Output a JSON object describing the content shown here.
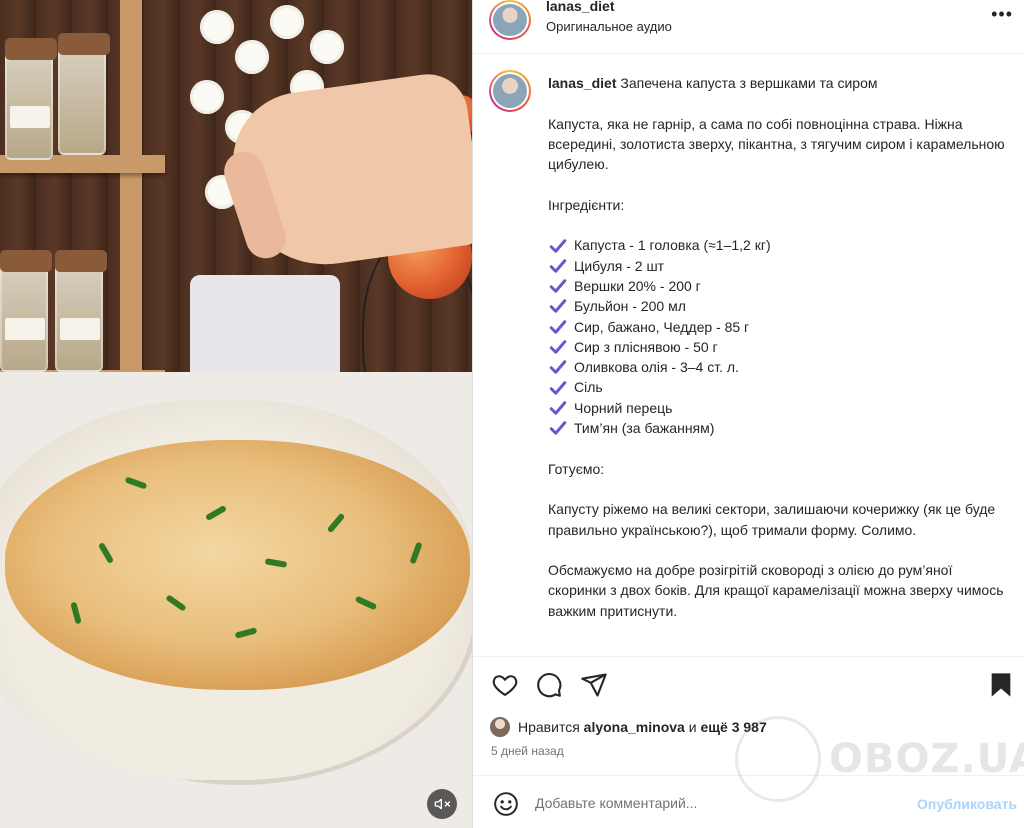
{
  "header": {
    "username": "lanas_diet",
    "subtitle": "Оригинальное аудио",
    "more_icon": "more-horizontal-icon"
  },
  "caption": {
    "username": "lanas_diet",
    "title": "Запечена капуста з вершками та сиром",
    "intro": "Капуста, яка не гарнір, а сама по собі повноцінна страва. Ніжна всередині, золотиста зверху, пікантна, з тягучим сиром і карамельною цибулею.",
    "ingredients_heading": "Інгредієнти:",
    "ingredients": [
      "Капуста - 1 головка (≈1–1,2 кг)",
      "Цибуля - 2 шт",
      "Вершки 20% - 200 г",
      "Бульйон - 200 мл",
      "Сир, бажано, Чеддер - 85 г",
      "Сир з пліснявою - 50 г",
      "Оливкова олія - 3–4 ст. л.",
      "Сіль",
      "Чорний перець",
      "Тим’ян (за бажанням)"
    ],
    "check_icon": "check-icon",
    "cooking_heading": "Готуємо:",
    "step1": "Капусту ріжемо на великі сектори, залишаючи кочерижку (як це буде правильно українською?), щоб тримали форму. Солимо.",
    "step2": "Обсмажуємо на добре розігрітій сковороді з олією до рум’яної скоринки з двох боків. Для кращої карамелізації можна зверху чимось важким притиснути."
  },
  "actions": {
    "like_icon": "heart-icon",
    "comment_icon": "comment-icon",
    "share_icon": "share-icon",
    "save_icon": "bookmark-icon"
  },
  "likes": {
    "prefix": "Нравится",
    "user": "alyona_minova",
    "connector": "и",
    "others": "ещё 3 987"
  },
  "time_ago": "5 дней назад",
  "comment": {
    "placeholder": "Добавьте комментарий...",
    "publish_label": "Опубликовать",
    "emoji_icon": "emoji-icon"
  },
  "media": {
    "mute_icon": "sound-off-icon"
  },
  "watermark": "OBOZ.UA",
  "colors": {
    "accent_check": "#6b57c9",
    "publish": "#a9d4fb",
    "muted_text": "#737373"
  }
}
